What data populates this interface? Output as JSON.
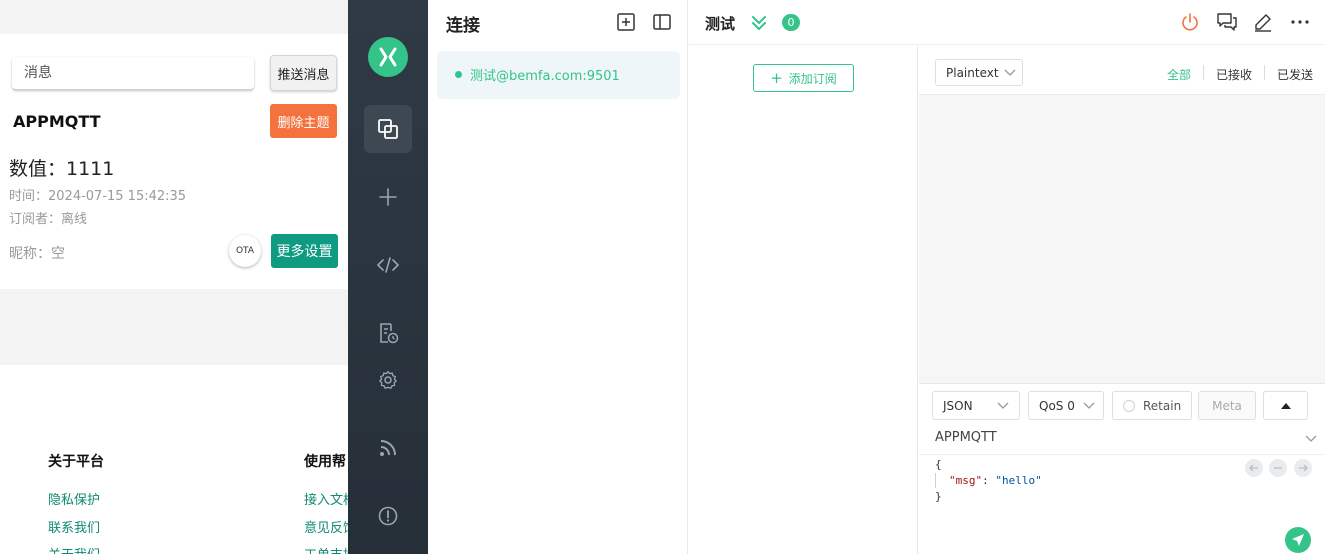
{
  "webpage": {
    "message_placeholder": "消息",
    "push_button": "推送消息",
    "topic_name": "APPMQTT",
    "delete_button": "删除主题",
    "value_line": "数值：1111",
    "time_line": "时间：2024-07-15 15:42:35",
    "subscriber_line": "订阅者：离线",
    "nickname_line": "昵称：空",
    "ota_button": "OTA",
    "more_settings_button": "更多设置",
    "footer": {
      "col1": {
        "heading": "关于平台",
        "links": [
          "隐私保护",
          "联系我们",
          "关于我们"
        ]
      },
      "col2": {
        "heading": "使用帮",
        "links": [
          "接入文档",
          "意见反馈",
          "工单支持"
        ]
      }
    }
  },
  "sidebar": {
    "items": [
      {
        "icon": "connections-icon",
        "active": true
      },
      {
        "icon": "plus-icon",
        "active": false
      },
      {
        "icon": "code-icon",
        "active": false
      },
      {
        "icon": "log-icon",
        "active": false
      },
      {
        "icon": "gear-icon",
        "active": false
      },
      {
        "icon": "feed-icon",
        "active": false
      },
      {
        "icon": "info-icon",
        "active": false
      }
    ]
  },
  "connections": {
    "title": "连接",
    "items": [
      {
        "name": "测试@bemfa.com:9501",
        "status": "connected"
      }
    ]
  },
  "header": {
    "connection_name": "测试",
    "unread_count": "0"
  },
  "subscriptions": {
    "add_button": "添加订阅"
  },
  "messages": {
    "payload_format": "Plaintext",
    "filters": [
      "全部",
      "已接收",
      "已发送"
    ],
    "active_filter": "全部"
  },
  "publish": {
    "format": "JSON",
    "qos": "QoS 0",
    "retain_label": "Retain",
    "meta_label": "Meta",
    "topic": "APPMQTT",
    "payload_lines": {
      "open": "{",
      "key": "\"msg\"",
      "colon": ": ",
      "value": "\"hello\"",
      "close": "}"
    }
  },
  "colors": {
    "accent": "#34c388",
    "delete": "#f4723e",
    "settings": "#0f9a82",
    "sidebar": "#2a343e"
  }
}
